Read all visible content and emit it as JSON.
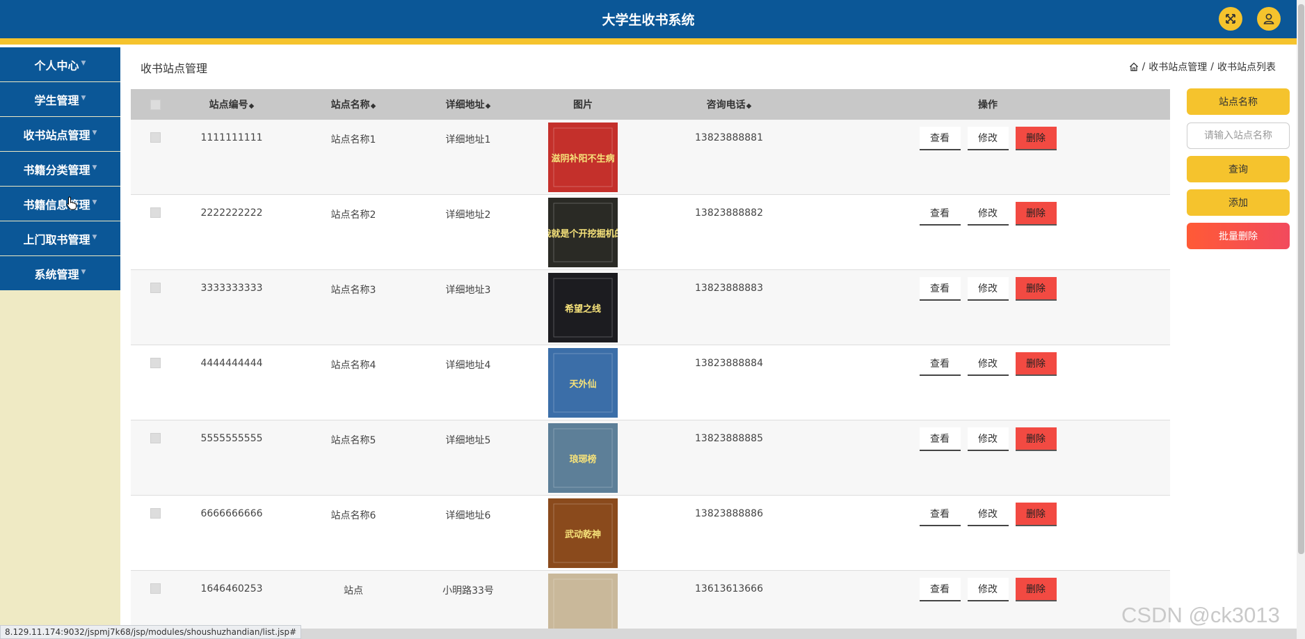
{
  "header": {
    "title": "大学生收书系统"
  },
  "sidebar": {
    "items": [
      {
        "label": "个人中心"
      },
      {
        "label": "学生管理"
      },
      {
        "label": "收书站点管理"
      },
      {
        "label": "书籍分类管理"
      },
      {
        "label": "书籍信息管理"
      },
      {
        "label": "上门取书管理"
      },
      {
        "label": "系统管理"
      }
    ]
  },
  "page": {
    "title": "收书站点管理",
    "breadcrumb": [
      "收书站点管理",
      "收书站点列表"
    ]
  },
  "table": {
    "headers": {
      "id": "站点编号",
      "name": "站点名称",
      "address": "详细地址",
      "image": "图片",
      "phone": "咨询电话",
      "ops": "操作"
    },
    "actions": {
      "view": "查看",
      "edit": "修改",
      "delete": "删除"
    },
    "rows": [
      {
        "id": "1111111111",
        "name": "站点名称1",
        "address": "详细地址1",
        "phone": "13823888881",
        "cover_text": "滋阴补阳不生病",
        "cover_bg": "#c4302b"
      },
      {
        "id": "2222222222",
        "name": "站点名称2",
        "address": "详细地址2",
        "phone": "13823888882",
        "cover_text": "我就是个开挖掘机的",
        "cover_bg": "#2a2a25"
      },
      {
        "id": "3333333333",
        "name": "站点名称3",
        "address": "详细地址3",
        "phone": "13823888883",
        "cover_text": "希望之线",
        "cover_bg": "#1c1c20"
      },
      {
        "id": "4444444444",
        "name": "站点名称4",
        "address": "详细地址4",
        "phone": "13823888884",
        "cover_text": "天外仙",
        "cover_bg": "#3b6ea8"
      },
      {
        "id": "5555555555",
        "name": "站点名称5",
        "address": "详细地址5",
        "phone": "13823888885",
        "cover_text": "琅琊榜",
        "cover_bg": "#5d7f98"
      },
      {
        "id": "6666666666",
        "name": "站点名称6",
        "address": "详细地址6",
        "phone": "13823888886",
        "cover_text": "武动乾神",
        "cover_bg": "#8a4a1c"
      },
      {
        "id": "1646460253",
        "name": "站点",
        "address": "小明路33号",
        "phone": "13613613666",
        "cover_text": "",
        "cover_bg": "#c9b89a"
      }
    ]
  },
  "search": {
    "field_label": "站点名称",
    "placeholder": "请输入站点名称",
    "query_button": "查询",
    "add_button": "添加",
    "batch_delete_button": "批量删除"
  },
  "statusbar": {
    "url": "8.129.11.174:9032/jspmj7k68/jsp/modules/shoushuzhandian/list.jsp#"
  },
  "watermark": {
    "text": "CSDN @ck3013"
  },
  "colors": {
    "primary": "#0b5797",
    "accent": "#f5c32d",
    "danger": "#f24a42",
    "sidebar_bg": "#efeac4"
  }
}
